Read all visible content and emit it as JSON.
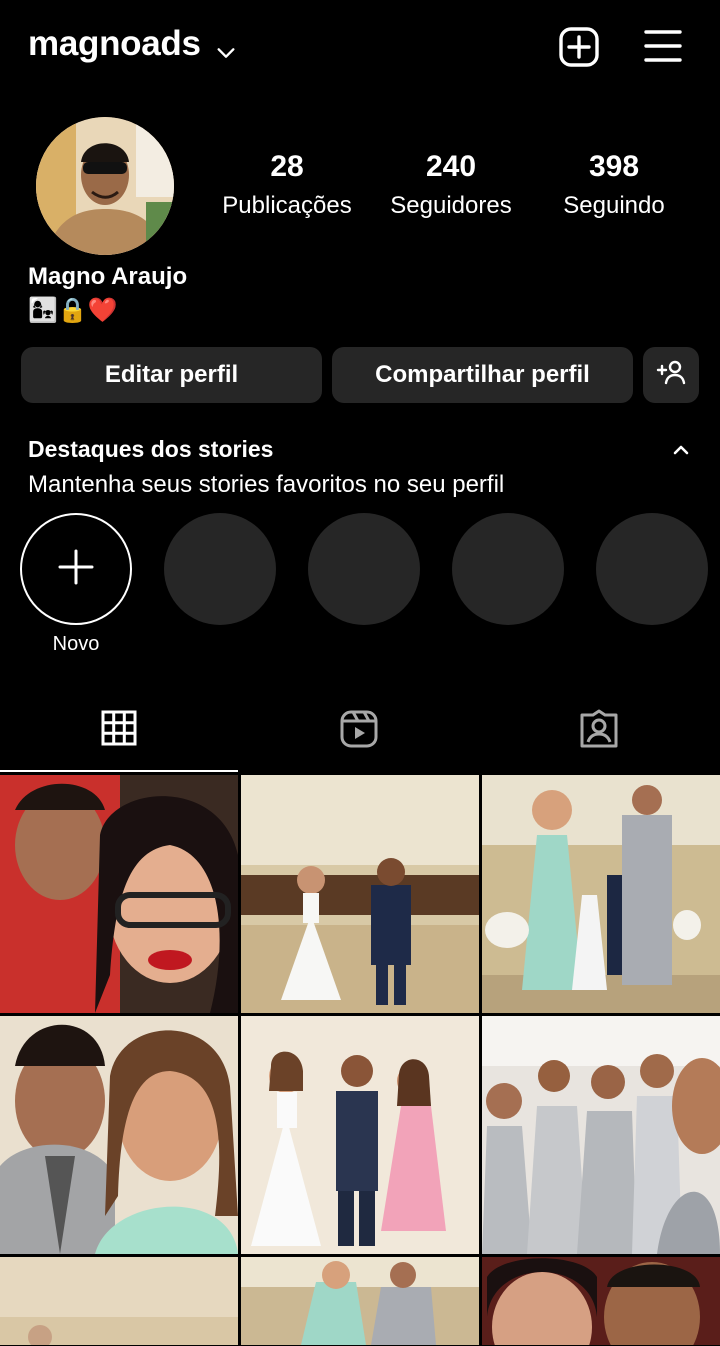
{
  "header": {
    "username": "magnoads",
    "new_post_icon": "plus-square-icon",
    "menu_icon": "hamburger-menu-icon"
  },
  "profile": {
    "name": "Magno Araujo",
    "bio": "👩‍👧🔒❤️",
    "stats": [
      {
        "value": "28",
        "label": "Publicações"
      },
      {
        "value": "240",
        "label": "Seguidores"
      },
      {
        "value": "398",
        "label": "Seguindo"
      }
    ]
  },
  "actions": {
    "edit": "Editar perfil",
    "share": "Compartilhar perfil",
    "add_user_icon": "add-user-icon"
  },
  "highlights": {
    "title": "Destaques dos stories",
    "subtitle": "Mantenha seus stories favoritos no seu perfil",
    "new_label": "Novo"
  },
  "tabs": [
    {
      "icon": "grid-icon",
      "active": true
    },
    {
      "icon": "reels-icon",
      "active": false
    },
    {
      "icon": "tagged-icon",
      "active": false
    }
  ],
  "colors": {
    "background": "#000000",
    "button": "#262626",
    "text": "#ffffff"
  }
}
